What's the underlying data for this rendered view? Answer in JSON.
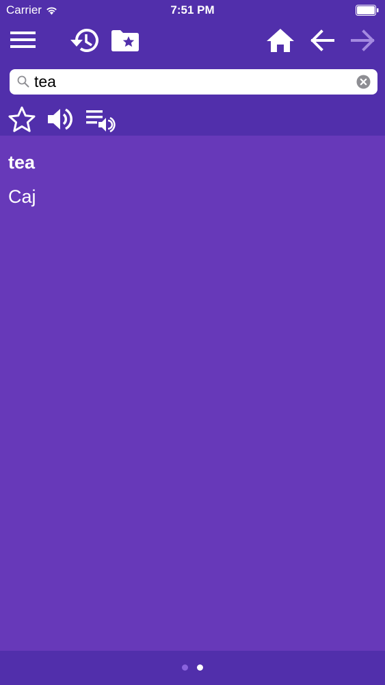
{
  "status_bar": {
    "carrier": "Carrier",
    "time": "7:51 PM",
    "wifi_icon": "wifi-icon",
    "battery_icon": "battery-icon"
  },
  "toolbar": {
    "menu_icon": "hamburger-menu-icon",
    "history_icon": "history-icon",
    "favorites_folder_icon": "folder-star-icon",
    "home_icon": "home-icon",
    "back_icon": "arrow-left-icon",
    "forward_icon": "arrow-right-icon"
  },
  "search": {
    "value": "tea",
    "placeholder": "",
    "search_icon": "search-icon",
    "clear_icon": "clear-circle-icon"
  },
  "actions": {
    "favorite_icon": "star-outline-icon",
    "speak_icon": "speaker-icon",
    "speak_list_icon": "playlist-speaker-icon"
  },
  "entry": {
    "word": "tea",
    "translation": "Caj"
  },
  "pager": {
    "total": 2,
    "active_index": 1
  },
  "colors": {
    "header_bg": "#512fab",
    "content_bg": "#6739b9",
    "forward_disabled": "#a48ae0",
    "dot_inactive": "#8a63dd",
    "dot_active": "#ffffff"
  }
}
